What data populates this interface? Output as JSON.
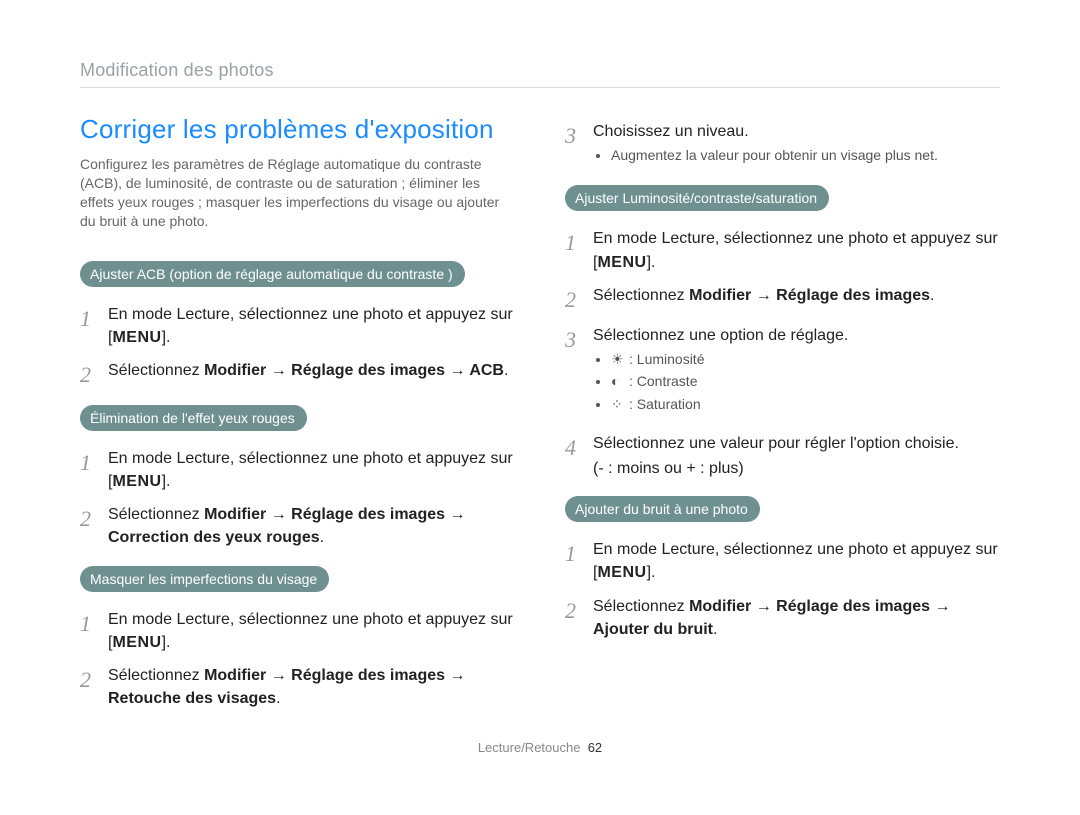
{
  "breadcrumb": "Modification des photos",
  "left": {
    "headline": "Corriger les problèmes d'exposition",
    "intro": "Configurez les paramètres de Réglage automatique du contraste (ACB), de luminosité, de contraste ou de saturation ; éliminer les effets yeux rouges ; masquer les imperfections du visage ou ajouter du bruit à une photo.",
    "section_acb": {
      "title": "Ajuster ACB (option de réglage automatique du contraste )",
      "steps": {
        "s1_pre": "En mode Lecture, sélectionnez une photo et appuyez sur [",
        "s1_btn": "MENU",
        "s1_post": "].",
        "s2_pre": "Sélectionnez ",
        "s2_path": "Modifier → Réglage des images → ACB",
        "s2_post": "."
      }
    },
    "section_redeye": {
      "title": "Élimination de l'effet yeux rouges",
      "steps": {
        "s1_pre": "En mode Lecture, sélectionnez une photo et appuyez sur [",
        "s1_btn": "MENU",
        "s1_post": "].",
        "s2_pre": "Sélectionnez ",
        "s2_path": "Modifier → Réglage des images → Correction des yeux rouges",
        "s2_post": "."
      }
    },
    "section_face": {
      "title": "Masquer les imperfections du visage",
      "steps": {
        "s1_pre": "En mode Lecture, sélectionnez une photo et appuyez sur [",
        "s1_btn": "MENU",
        "s1_post": "].",
        "s2_pre": "Sélectionnez ",
        "s2_path": "Modifier →  Réglage des images → Retouche des visages",
        "s2_post": "."
      }
    }
  },
  "right": {
    "step3_text": "Choisissez un niveau.",
    "step3_bullet": "Augmentez la valeur pour obtenir un visage plus net.",
    "section_bcs": {
      "title": "Ajuster Luminosité/contraste/saturation",
      "steps": {
        "s1_pre": "En mode Lecture, sélectionnez une photo et appuyez sur [",
        "s1_btn": "MENU",
        "s1_post": "].",
        "s2_pre": "Sélectionnez ",
        "s2_path": "Modifier → Réglage des images",
        "s2_post": ".",
        "s3_text": "Sélectionnez une option de réglage.",
        "icons": {
          "i1": {
            "glyph": "☀",
            "label": ": Luminosité"
          },
          "i2": {
            "glyph": "◐",
            "label": ": Contraste"
          },
          "i3": {
            "glyph": "⁘",
            "label": ": Saturation"
          }
        },
        "s4_line1": "Sélectionnez une valeur pour régler l'option choisie.",
        "s4_line2": "(- : moins ou + : plus)"
      }
    },
    "section_noise": {
      "title": "Ajouter du bruit à une photo",
      "steps": {
        "s1_pre": "En mode Lecture, sélectionnez une photo et appuyez sur [",
        "s1_btn": "MENU",
        "s1_post": "].",
        "s2_pre": "Sélectionnez ",
        "s2_path": "Modifier → Réglage des images → Ajouter du bruit",
        "s2_post": "."
      }
    }
  },
  "footer": {
    "section": "Lecture/Retouche",
    "page": "62"
  }
}
